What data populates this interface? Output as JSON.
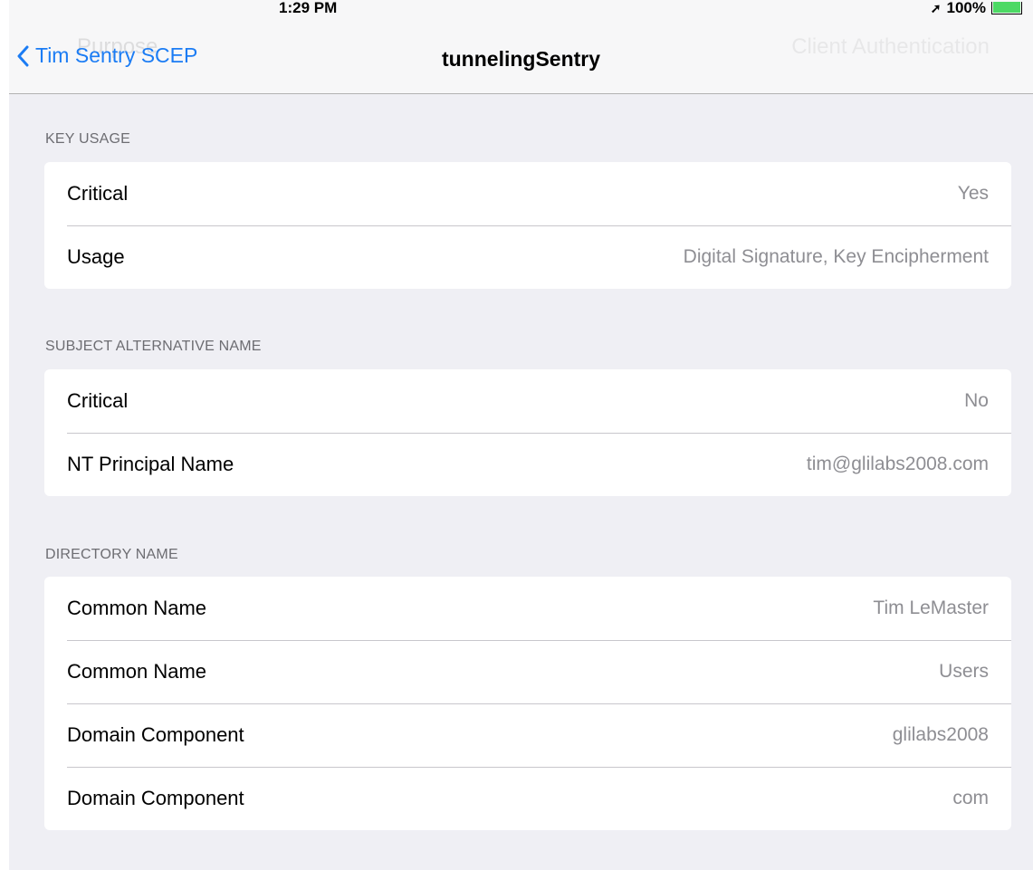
{
  "status_bar": {
    "time": "1:29 PM",
    "battery": "100%"
  },
  "nav": {
    "back_label": "Tim Sentry SCEP",
    "title": "tunnelingSentry",
    "ghost_left": "Purpose",
    "ghost_right": "Client Authentication"
  },
  "sections": {
    "key_usage": {
      "header": "KEY USAGE",
      "rows": [
        {
          "label": "Critical",
          "value": "Yes"
        },
        {
          "label": "Usage",
          "value": "Digital Signature, Key Encipherment"
        }
      ]
    },
    "san": {
      "header": "SUBJECT ALTERNATIVE NAME",
      "rows": [
        {
          "label": "Critical",
          "value": "No"
        },
        {
          "label": "NT Principal Name",
          "value": "tim@glilabs2008.com"
        }
      ]
    },
    "directory_name": {
      "header": "DIRECTORY NAME",
      "rows": [
        {
          "label": "Common Name",
          "value": "Tim LeMaster"
        },
        {
          "label": "Common Name",
          "value": "Users"
        },
        {
          "label": "Domain Component",
          "value": "glilabs2008"
        },
        {
          "label": "Domain Component",
          "value": "com"
        }
      ]
    }
  },
  "icons": {
    "back": "chevron-left-icon",
    "location": "location-arrow-icon",
    "battery": "battery-icon"
  },
  "colors": {
    "accent": "#1b7cf4",
    "background": "#efeff4",
    "value_text": "#8e8e93",
    "battery_fill": "#4cd964"
  }
}
